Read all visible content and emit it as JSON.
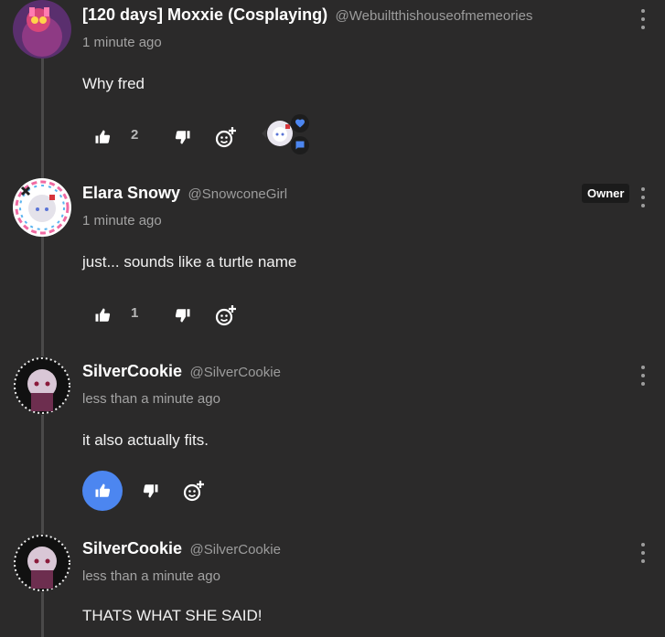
{
  "comments": [
    {
      "display_name": "[120 days] Moxxie (Cosplaying)",
      "handle": "@Webuiltthishouseofmemeories",
      "timestamp": "1 minute ago",
      "text": "Why fred",
      "likes": "2",
      "liked": false,
      "reactions": [
        "heart-icon",
        "chat-bubble-icon"
      ]
    },
    {
      "display_name": "Elara Snowy",
      "handle": "@SnowconeGirl",
      "badge": "Owner",
      "timestamp": "1 minute ago",
      "text": "just... sounds like a turtle name",
      "likes": "1",
      "liked": false
    },
    {
      "display_name": "SilverCookie",
      "handle": "@SilverCookie",
      "timestamp": "less than a minute ago",
      "text": "it also actually fits.",
      "likes": "",
      "liked": true
    },
    {
      "display_name": "SilverCookie",
      "handle": "@SilverCookie",
      "timestamp": "less than a minute ago",
      "text": "THATS WHAT SHE SAID!"
    }
  ],
  "colors": {
    "background": "#2b2a2a",
    "accent_like": "#4c86f0",
    "thread_line": "#4a4949"
  },
  "icons": {
    "like": "thumbs-up-icon",
    "dislike": "thumbs-down-icon",
    "react": "add-reaction-icon",
    "more": "more-vertical-icon"
  }
}
